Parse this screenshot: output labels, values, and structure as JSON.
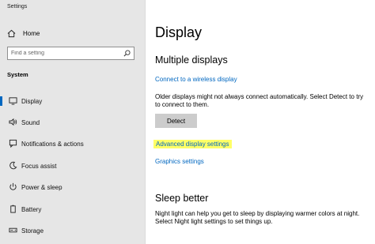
{
  "window": {
    "title": "Settings"
  },
  "sidebar": {
    "home_label": "Home",
    "search": {
      "placeholder": "Find a setting"
    },
    "section_label": "System",
    "items": [
      {
        "label": "Display",
        "icon": "monitor-icon",
        "active": true
      },
      {
        "label": "Sound",
        "icon": "speaker-icon"
      },
      {
        "label": "Notifications & actions",
        "icon": "notifications-icon"
      },
      {
        "label": "Focus assist",
        "icon": "moon-icon"
      },
      {
        "label": "Power & sleep",
        "icon": "power-icon"
      },
      {
        "label": "Battery",
        "icon": "battery-icon"
      },
      {
        "label": "Storage",
        "icon": "storage-icon"
      }
    ]
  },
  "main": {
    "title": "Display",
    "multiple_displays": {
      "heading": "Multiple displays",
      "wireless_link": "Connect to a wireless display",
      "info": "Older displays might not always connect automatically. Select Detect to try to connect to them.",
      "detect_button": "Detect",
      "advanced_link": "Advanced display settings",
      "graphics_link": "Graphics settings"
    },
    "sleep_better": {
      "heading": "Sleep better",
      "info": "Night light can help you get to sleep by displaying warmer colors at night. Select Night light settings to set things up."
    }
  },
  "colors": {
    "accent": "#0067c0",
    "sidebar_bg": "#e6e6e6",
    "highlight": "#ffff66"
  }
}
